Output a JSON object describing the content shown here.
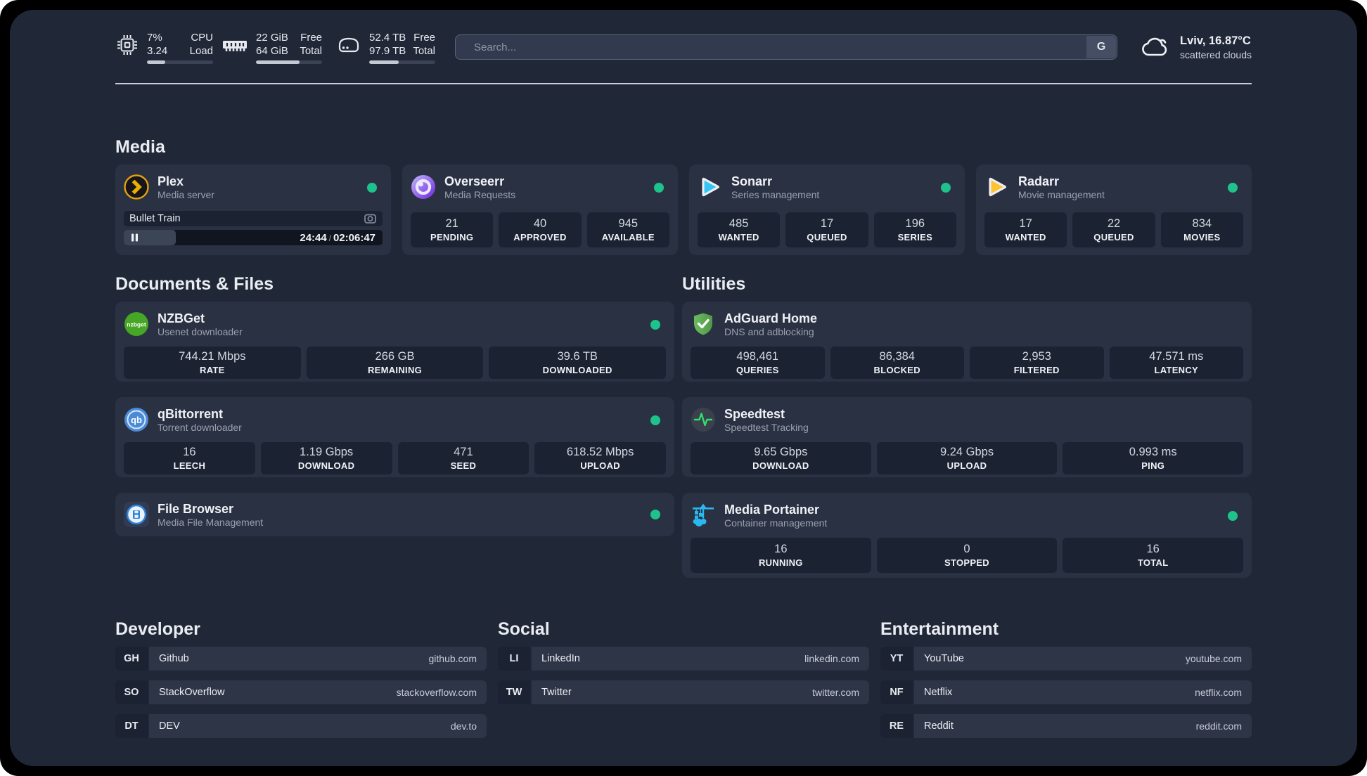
{
  "topbar": {
    "cpu": {
      "value_primary": "7%",
      "value_secondary": "3.24",
      "label_primary": "CPU",
      "label_secondary": "Load",
      "progress_percent": 28
    },
    "memory": {
      "value_primary": "22 GiB",
      "value_secondary": "64 GiB",
      "label_primary": "Free",
      "label_secondary": "Total",
      "progress_percent": 66
    },
    "storage": {
      "value_primary": "52.4 TB",
      "value_secondary": "97.9 TB",
      "label_primary": "Free",
      "label_secondary": "Total",
      "progress_percent": 45
    },
    "search": {
      "placeholder": "Search...",
      "engine_button": "G"
    },
    "weather": {
      "headline": "Lviv, 16.87°C",
      "condition": "scattered clouds"
    }
  },
  "colors": {
    "status_online": "#1ec28b",
    "background": "#202737",
    "card": "#2a3142",
    "stat_box": "#1b2232"
  },
  "sections": {
    "media": {
      "heading": "Media",
      "apps": {
        "plex": {
          "name": "Plex",
          "description": "Media server",
          "now_playing": "Bullet Train",
          "elapsed": "24:44",
          "separator": "/",
          "total": "02:06:47",
          "progress_percent": 20
        },
        "overseerr": {
          "name": "Overseerr",
          "description": "Media Requests",
          "stats": [
            {
              "value": "21",
              "label": "PENDING"
            },
            {
              "value": "40",
              "label": "APPROVED"
            },
            {
              "value": "945",
              "label": "AVAILABLE"
            }
          ]
        },
        "sonarr": {
          "name": "Sonarr",
          "description": "Series management",
          "stats": [
            {
              "value": "485",
              "label": "WANTED"
            },
            {
              "value": "17",
              "label": "QUEUED"
            },
            {
              "value": "196",
              "label": "SERIES"
            }
          ]
        },
        "radarr": {
          "name": "Radarr",
          "description": "Movie management",
          "stats": [
            {
              "value": "17",
              "label": "WANTED"
            },
            {
              "value": "22",
              "label": "QUEUED"
            },
            {
              "value": "834",
              "label": "MOVIES"
            }
          ]
        }
      }
    },
    "documents": {
      "heading": "Documents & Files",
      "apps": {
        "nzbget": {
          "name": "NZBGet",
          "description": "Usenet downloader",
          "stats": [
            {
              "value": "744.21 Mbps",
              "label": "RATE"
            },
            {
              "value": "266 GB",
              "label": "REMAINING"
            },
            {
              "value": "39.6 TB",
              "label": "DOWNLOADED"
            }
          ]
        },
        "qbittorrent": {
          "name": "qBittorrent",
          "description": "Torrent downloader",
          "stats": [
            {
              "value": "16",
              "label": "LEECH"
            },
            {
              "value": "1.19 Gbps",
              "label": "DOWNLOAD"
            },
            {
              "value": "471",
              "label": "SEED"
            },
            {
              "value": "618.52 Mbps",
              "label": "UPLOAD"
            }
          ]
        },
        "filebrowser": {
          "name": "File Browser",
          "description": "Media File Management"
        }
      }
    },
    "utilities": {
      "heading": "Utilities",
      "apps": {
        "adguard": {
          "name": "AdGuard Home",
          "description": "DNS and adblocking",
          "stats": [
            {
              "value": "498,461",
              "label": "QUERIES"
            },
            {
              "value": "86,384",
              "label": "BLOCKED"
            },
            {
              "value": "2,953",
              "label": "FILTERED"
            },
            {
              "value": "47.571 ms",
              "label": "LATENCY"
            }
          ]
        },
        "speedtest": {
          "name": "Speedtest",
          "description": "Speedtest Tracking",
          "stats": [
            {
              "value": "9.65 Gbps",
              "label": "DOWNLOAD"
            },
            {
              "value": "9.24 Gbps",
              "label": "UPLOAD"
            },
            {
              "value": "0.993 ms",
              "label": "PING"
            }
          ]
        },
        "portainer": {
          "name": "Media Portainer",
          "description": "Container management",
          "stats": [
            {
              "value": "16",
              "label": "RUNNING"
            },
            {
              "value": "0",
              "label": "STOPPED"
            },
            {
              "value": "16",
              "label": "TOTAL"
            }
          ]
        }
      }
    },
    "links": [
      {
        "heading": "Developer",
        "items": [
          {
            "tag": "GH",
            "name": "Github",
            "url": "github.com"
          },
          {
            "tag": "SO",
            "name": "StackOverflow",
            "url": "stackoverflow.com"
          },
          {
            "tag": "DT",
            "name": "DEV",
            "url": "dev.to"
          }
        ]
      },
      {
        "heading": "Social",
        "items": [
          {
            "tag": "LI",
            "name": "LinkedIn",
            "url": "linkedin.com"
          },
          {
            "tag": "TW",
            "name": "Twitter",
            "url": "twitter.com"
          }
        ]
      },
      {
        "heading": "Entertainment",
        "items": [
          {
            "tag": "YT",
            "name": "YouTube",
            "url": "youtube.com"
          },
          {
            "tag": "NF",
            "name": "Netflix",
            "url": "netflix.com"
          },
          {
            "tag": "RE",
            "name": "Reddit",
            "url": "reddit.com"
          }
        ]
      }
    ]
  }
}
